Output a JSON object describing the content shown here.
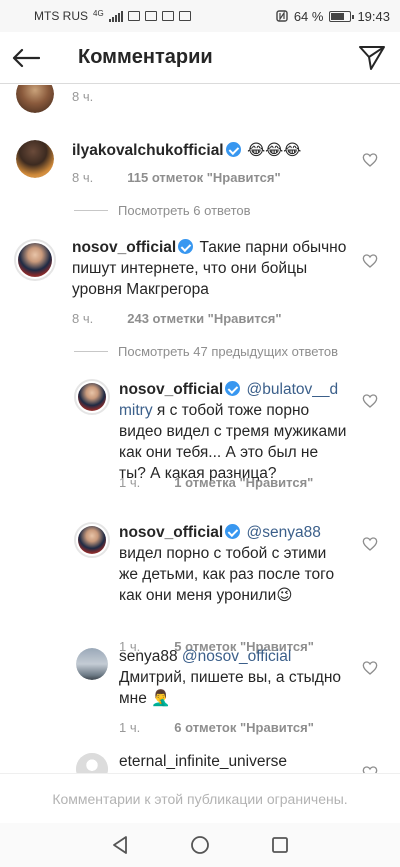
{
  "status_bar": {
    "carrier": "MTS RUS",
    "network": "4G",
    "battery": "64 %",
    "time": "19:43"
  },
  "header": {
    "title": "Комментарии",
    "back_icon": "arrow-left-icon",
    "send_icon": "paper-plane-icon"
  },
  "comments": [
    {
      "time": "8 ч."
    },
    {
      "username": "ilyakovalchukofficial",
      "text": "😂😂😂",
      "time": "8 ч.",
      "likes": "115 отметок \"Нравится\"",
      "view_replies": "Посмотреть 6 ответов"
    },
    {
      "username": "nosov_official",
      "text": "Такие парни обычно пишут интернете, что они бойцы уровня Макгрегора",
      "time": "8 ч.",
      "likes": "243 отметки \"Нравится\"",
      "view_replies": "Посмотреть 47 предыдущих ответов"
    }
  ],
  "replies": [
    {
      "username": "nosov_official",
      "mention": "@bulatov__dmitry",
      "text": "я с тобой тоже порно видео видел с тремя мужиками как они тебя... А это был не ты?  А какая разница?",
      "time": "1 ч.",
      "likes": "1 отметка \"Нравится\""
    },
    {
      "username": "nosov_official",
      "mention": "@senya88",
      "text": "видел порно с тобой с этими же детьми, как раз после того как они меня уронили😉",
      "time": "1 ч.",
      "likes": "5 отметок \"Нравится\""
    },
    {
      "username": "senya88",
      "mention": "@nosov_official",
      "text": "Дмитрий, пишете вы, а стыдно мне 🤦‍♂️",
      "time": "1 ч.",
      "likes": "6 отметок \"Нравится\""
    },
    {
      "username": "eternal_infinite_universe"
    }
  ],
  "footer": {
    "restricted_text": "Комментарии к этой публикации ограничены."
  },
  "nav": {
    "back": "triangle-back-icon",
    "home": "circle-home-icon",
    "recents": "square-recents-icon"
  }
}
